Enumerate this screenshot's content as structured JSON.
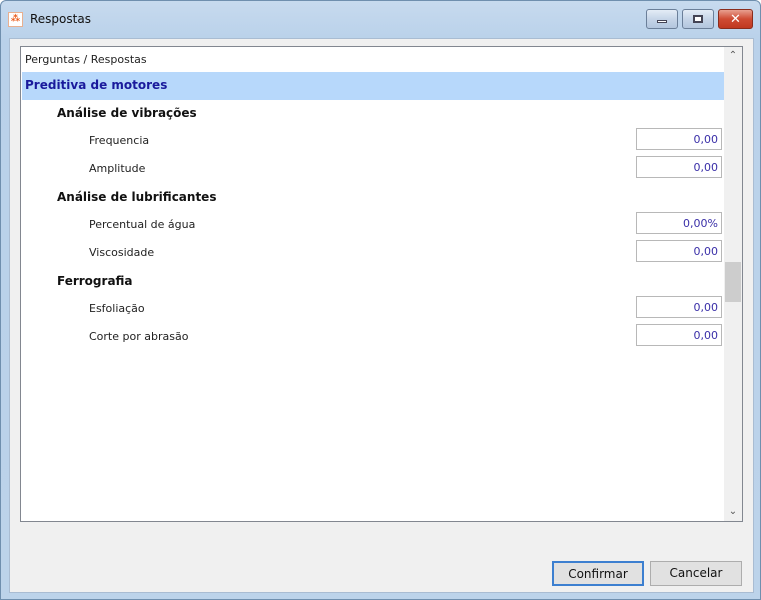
{
  "window": {
    "title": "Respostas",
    "app_icon": "app-logo-icon",
    "controls": [
      "minimize",
      "maximize",
      "close"
    ]
  },
  "list": {
    "header": "Perguntas / Respostas",
    "group": "Preditiva de motores",
    "categories": [
      {
        "label": "Análise de vibrações",
        "items": [
          {
            "label": "Frequencia",
            "value": "0,00"
          },
          {
            "label": "Amplitude",
            "value": "0,00"
          }
        ]
      },
      {
        "label": "Análise de lubrificantes",
        "items": [
          {
            "label": "Percentual de água",
            "value": "0,00%"
          },
          {
            "label": "Viscosidade",
            "value": "0,00"
          }
        ]
      },
      {
        "label": "Ferrografia",
        "items": [
          {
            "label": "Esfoliação",
            "value": "0,00"
          },
          {
            "label": "Corte por abrasão",
            "value": "0,00"
          }
        ]
      }
    ]
  },
  "buttons": {
    "confirm": "Confirmar",
    "cancel": "Cancelar"
  },
  "colors": {
    "selection": "#b7d8fb",
    "group_text": "#1a1a9c",
    "value_text": "#3a2fa8"
  }
}
